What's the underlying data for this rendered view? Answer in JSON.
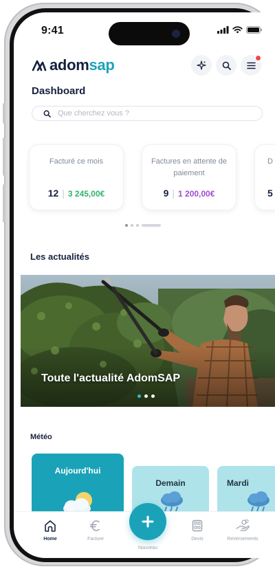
{
  "status_bar": {
    "time": "9:41"
  },
  "header": {
    "logo_text_main": "adom",
    "logo_text_accent": "sap",
    "notification_count": 1
  },
  "dashboard": {
    "title": "Dashboard",
    "search": {
      "placeholder": "Que cherchez vous ?"
    },
    "stats": [
      {
        "label": "Facturé ce mois",
        "count": "12",
        "amount": "3 245,00€",
        "amount_color": "#2fb56a"
      },
      {
        "label": "Factures en attente de paiement",
        "count": "9",
        "amount": "1 200,00€",
        "amount_color": "#a24ad1"
      },
      {
        "label": "D",
        "count": "5",
        "amount": ""
      }
    ],
    "carousel_page": 1
  },
  "news": {
    "section_title": "Les actualités",
    "caption": "Toute l'actualité AdomSAP"
  },
  "weather": {
    "section_title": "Météo",
    "days": [
      {
        "label": "Aujourd'hui",
        "icon": "sun-cloud-icon"
      },
      {
        "label": "Demain",
        "icon": "rain-cloud-icon"
      },
      {
        "label": "Mardi",
        "icon": "rain-cloud-icon"
      }
    ]
  },
  "bottom_nav": {
    "items": [
      {
        "label": "Home",
        "icon": "home-icon",
        "active": true
      },
      {
        "label": "Facture",
        "icon": "euro-icon",
        "active": false
      },
      {
        "label": "Nouveau",
        "icon": "plus-icon",
        "active": false
      },
      {
        "label": "Devis",
        "icon": "calculator-icon",
        "active": false
      },
      {
        "label": "Reversements",
        "icon": "hand-money-icon",
        "active": false
      }
    ]
  },
  "colors": {
    "brand_teal": "#1aa3b8",
    "brand_navy": "#16213f"
  }
}
